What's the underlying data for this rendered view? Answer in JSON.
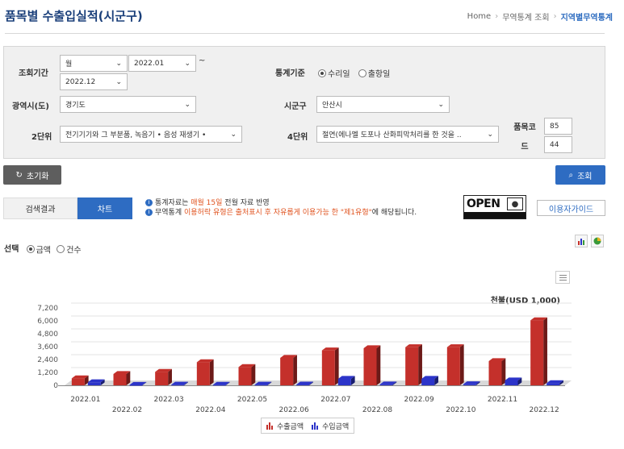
{
  "page": {
    "title": "품목별 수출입실적(시군구)"
  },
  "breadcrumb": {
    "home": "Home",
    "sep": "›",
    "item1": "무역통계 조회",
    "item2": "지역별무역통계"
  },
  "form": {
    "period_label": "조회기간",
    "period_unit": "월",
    "start": "2022.01",
    "tilde": "~",
    "end": "2022.12",
    "basis_label": "통계기준",
    "basis_options": [
      "수리일",
      "출항일"
    ],
    "basis_selected": "수리일",
    "province_label": "광역시(도)",
    "province_value": "경기도",
    "city_label": "시군구",
    "city_value": "안산시",
    "level2_label": "2단위",
    "level2_value": "전기기기와 그 부분품, 녹음기 • 음성 재생기 •",
    "level4_label": "4단위",
    "level4_value": "절연(에나멜 도포나 산화피막처리를 한 것을 ..",
    "code_label": "품목코드",
    "code_value1": "85",
    "code_value2": "44"
  },
  "buttons": {
    "reset": "초기화",
    "search": "조회",
    "guide": "이용자가이드"
  },
  "tabs": {
    "results": "검색결과",
    "chart": "차트"
  },
  "notes": {
    "line1_pre": "통계자료는 ",
    "line1_hl": "매월 15일",
    "line1_post": " 전월 자료 반영",
    "line2_pre": "무역통계 ",
    "line2_hl": "이용허락 유형은 출처표시 후 자유롭게 이용가능 한 \"제1유형\"",
    "line2_post": "에 해당됩니다.",
    "open_word": "OPEN"
  },
  "selector": {
    "label": "선택",
    "options": [
      "금액",
      "건수"
    ],
    "selected": "금액"
  },
  "icons": {
    "reset": "refresh-icon",
    "search": "search-icon",
    "bar": "bar-chart-icon",
    "pie": "pie-chart-icon",
    "menu": "hamburger-menu-icon"
  },
  "chart_data": {
    "type": "bar",
    "unit": "천불(USD 1,000)",
    "categories": [
      "2022.01",
      "2022.02",
      "2022.03",
      "2022.04",
      "2022.05",
      "2022.06",
      "2022.07",
      "2022.08",
      "2022.09",
      "2022.10",
      "2022.11",
      "2022.12"
    ],
    "series": [
      {
        "name": "수출금액",
        "color": "#c4302b",
        "values": [
          650,
          1050,
          1250,
          2150,
          1700,
          2550,
          3250,
          3450,
          3550,
          3550,
          2250,
          6050
        ]
      },
      {
        "name": "수입금액",
        "color": "#2c34c9",
        "values": [
          280,
          40,
          60,
          50,
          60,
          70,
          600,
          80,
          600,
          100,
          450,
          200
        ]
      }
    ],
    "yticks": [
      "0",
      "1,200",
      "2,400",
      "3,600",
      "4,800",
      "6,000",
      "7,200"
    ],
    "ylim": [
      0,
      7200
    ],
    "grid": true,
    "legend": "bottom-center"
  },
  "colors": {
    "brand": "#2e6cc2",
    "title": "#1a3f7a",
    "highlight": "#e0531f"
  }
}
